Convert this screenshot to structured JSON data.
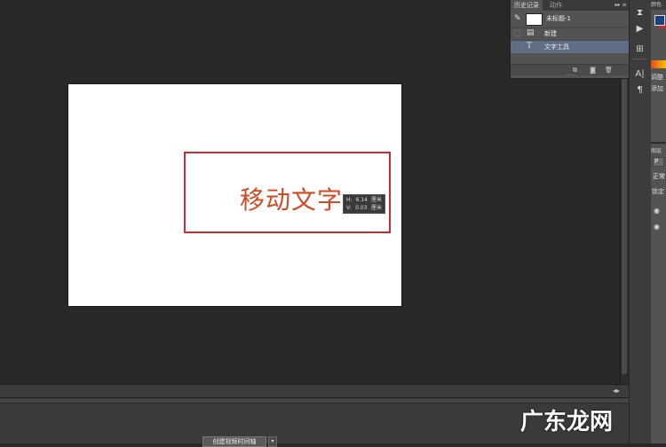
{
  "canvas": {
    "text": "移动文字",
    "text_color": "#d24a22",
    "selection_color": "#cc2c2c",
    "tooltip": {
      "row1_label": "H:",
      "row1_value": "6.14",
      "row1_unit": "厘米",
      "row2_label": "V:",
      "row2_value": "0.03",
      "row2_unit": "厘米"
    }
  },
  "history_panel": {
    "tabs": [
      "历史记录",
      "动作"
    ],
    "menu_icon": "panel-menu-icon",
    "snapshot_label": "未标题-1",
    "items": [
      {
        "label": "新建",
        "icon": "document-icon"
      },
      {
        "label": "文字工具",
        "icon": "text-tool-icon"
      }
    ],
    "footer_icons": [
      "new-document-from-state-icon",
      "camera-icon",
      "trash-icon"
    ]
  },
  "bottom_panel": {
    "timeline_button": "创建视频时间轴",
    "dropdown_glyph": "▾"
  },
  "right_panels": {
    "color_tab": "颜色",
    "foreground": "#1c3f7f",
    "background": "#c82a2a",
    "adjust_label": "调整",
    "add_label": "添加",
    "layers_label": "图层",
    "kind": "P",
    "blend_mode": "正常",
    "lock_label": "锁定"
  },
  "watermark": "广东龙网"
}
